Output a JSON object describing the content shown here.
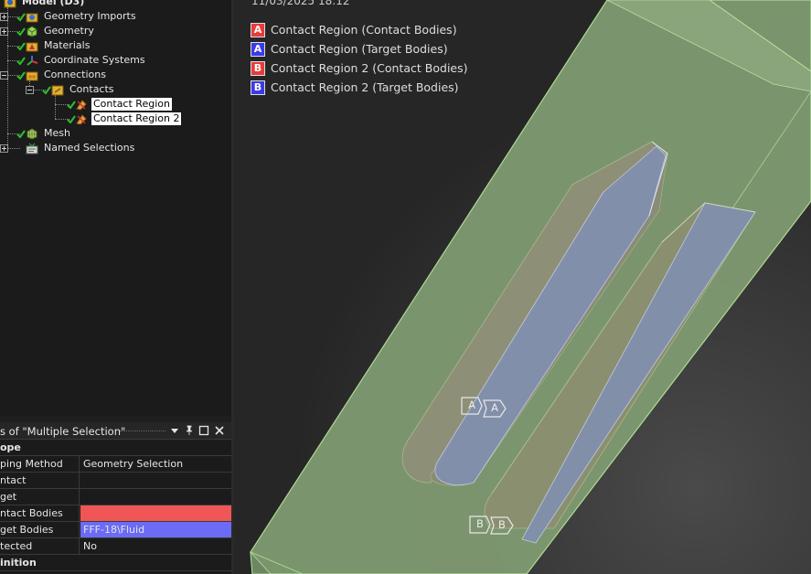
{
  "tree": {
    "root_label": "Model (D3)",
    "items": [
      {
        "label": "Geometry Imports",
        "icon": "geometry-imports-icon"
      },
      {
        "label": "Geometry",
        "icon": "geometry-icon"
      },
      {
        "label": "Materials",
        "icon": "materials-icon"
      },
      {
        "label": "Coordinate Systems",
        "icon": "coordinate-systems-icon"
      },
      {
        "label": "Connections",
        "icon": "connections-icon"
      },
      {
        "label": "Contacts",
        "icon": "contacts-folder-icon"
      },
      {
        "label": "Contact Region",
        "icon": "contact-region-icon"
      },
      {
        "label": "Contact Region 2",
        "icon": "contact-region-icon"
      },
      {
        "label": "Mesh",
        "icon": "mesh-icon"
      },
      {
        "label": "Named Selections",
        "icon": "named-selections-icon"
      }
    ]
  },
  "details": {
    "title": "s of \"Multiple Selection\"",
    "rows": [
      {
        "key": "ope",
        "value": "",
        "group": true
      },
      {
        "key": "ping Method",
        "value": "Geometry Selection"
      },
      {
        "key": "ntact",
        "value": ""
      },
      {
        "key": "get",
        "value": ""
      },
      {
        "key": "ntact Bodies",
        "value": "",
        "bg": "#f05656"
      },
      {
        "key": "get Bodies",
        "value": "FFF-18\\Fluid",
        "bg": "#6b6bf5"
      },
      {
        "key": "tected",
        "value": "No"
      },
      {
        "key": "inition",
        "value": "",
        "group": true
      }
    ]
  },
  "viewport": {
    "date": "11/03/2025 18:12",
    "legend": [
      {
        "badge": "A",
        "label": "Contact Region (Contact Bodies)",
        "color": "#e83b3b"
      },
      {
        "badge": "A",
        "label": "Contact Region (Target Bodies)",
        "color": "#3b3be8"
      },
      {
        "badge": "B",
        "label": "Contact Region 2 (Contact Bodies)",
        "color": "#e83b3b"
      },
      {
        "badge": "B",
        "label": "Contact Region 2 (Target Bodies)",
        "color": "#3b3be8"
      }
    ],
    "tags": {
      "a1": "A",
      "a2": "A",
      "b1": "B",
      "b2": "B"
    },
    "colors": {
      "body_fill": "#7f9a72",
      "body_edge": "#b6e39a",
      "slot_face": "#8d8f77",
      "target_face": "#8190b0",
      "background": "#2a2a2a"
    }
  }
}
